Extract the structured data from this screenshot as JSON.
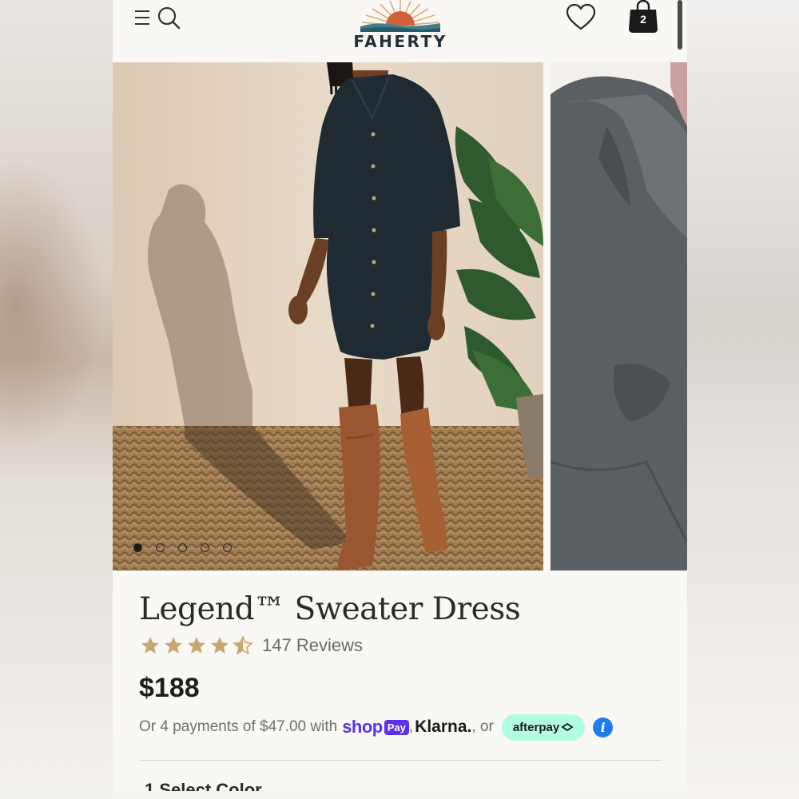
{
  "header": {
    "brand": "FAHERTY",
    "cart_count": "2"
  },
  "gallery": {
    "dot_count": 5,
    "active_dot": 0
  },
  "product": {
    "title": "Legend™ Sweater Dress",
    "rating": 4.5,
    "rating_max": 5,
    "reviews": "147 Reviews",
    "price": "$188",
    "installments": {
      "prefix": "Or 4 payments of $47.00 with",
      "shop_word": "shop",
      "shop_pay_box": "Pay",
      "comma": ",",
      "klarna": "Klarna.",
      "or_text": ", or",
      "afterpay": "afterpay",
      "info": "i"
    }
  },
  "next_section": {
    "label": "1 Select Color"
  },
  "colors": {
    "brand_navy": "#22303c",
    "star_gold": "#c9a66b",
    "shop_purple": "#5a31f4",
    "afterpay_mint": "#b2fce4",
    "info_blue": "#1f7cf0"
  }
}
